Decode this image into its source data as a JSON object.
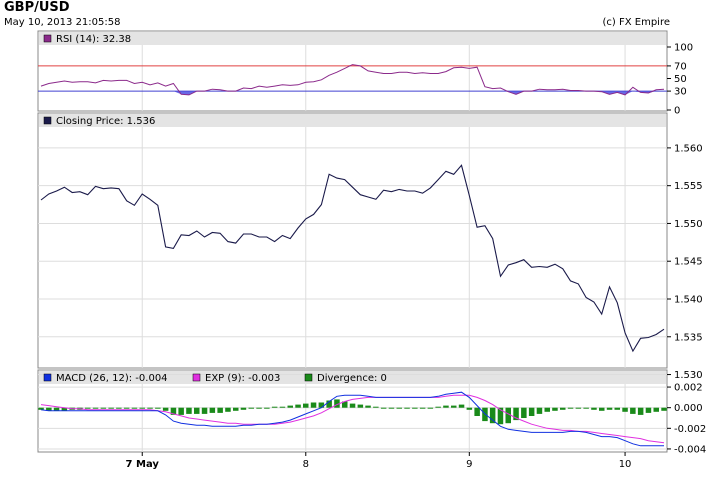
{
  "header": {
    "symbol": "GBP/USD",
    "datetime": "May 10, 2013 21:05:58",
    "copyright": "(c) FX Empire"
  },
  "colors": {
    "price": "#1a1a4a",
    "rsi": "#8b2a8b",
    "rsi_fill": "#4f4fe0",
    "overbought": "#e04040",
    "oversold": "#4040d0",
    "macd": "#1030e0",
    "exp": "#e030e0",
    "divergence": "#1a8a1a",
    "legend_bar": "#e4e4e4",
    "grid": "#dddddd"
  },
  "chart_data": [
    {
      "type": "line",
      "name": "rsi",
      "legend": "RSI (14): 32.38",
      "ylim": [
        0,
        100
      ],
      "yticks": [
        "100",
        "70",
        "50",
        "30",
        "0"
      ],
      "ytick_values": [
        100,
        70,
        50,
        30,
        0
      ],
      "levels": [
        70,
        30
      ],
      "x": [
        0,
        1,
        2,
        3,
        4,
        5,
        6,
        7,
        8,
        9,
        10,
        11,
        12,
        13,
        14,
        15,
        16,
        17,
        18,
        19,
        20,
        21,
        22,
        23,
        24,
        25,
        26,
        27,
        28,
        29,
        30,
        31,
        32,
        33,
        34,
        35,
        36,
        37,
        38,
        39,
        40,
        41,
        42,
        43,
        44,
        45,
        46,
        47,
        48,
        49,
        50,
        51,
        52,
        53,
        54,
        55,
        56,
        57,
        58,
        59,
        60,
        61,
        62,
        63,
        64,
        65,
        66,
        67,
        68,
        69,
        70,
        71,
        72,
        73,
        74,
        75,
        76,
        77,
        78,
        79,
        80
      ],
      "values": [
        38,
        42,
        44,
        46,
        44,
        45,
        45,
        43,
        47,
        46,
        47,
        47,
        42,
        44,
        40,
        43,
        38,
        42,
        25,
        24,
        30,
        30,
        33,
        32,
        30,
        30,
        35,
        34,
        38,
        36,
        38,
        40,
        39,
        40,
        44,
        45,
        48,
        55,
        60,
        66,
        72,
        70,
        62,
        60,
        58,
        58,
        60,
        60,
        58,
        59,
        58,
        58,
        61,
        67,
        68,
        66,
        68,
        37,
        34,
        35,
        29,
        25,
        30,
        30,
        33,
        32,
        32,
        33,
        31,
        31,
        30,
        30,
        29,
        25,
        28,
        24,
        36,
        28,
        27,
        32,
        33
      ]
    },
    {
      "type": "line",
      "name": "price",
      "legend": "Closing Price: 1.536",
      "ylim": [
        1.531,
        1.5625
      ],
      "yticks": [
        "1.560",
        "1.555",
        "1.550",
        "1.545",
        "1.540",
        "1.535",
        "1.530"
      ],
      "ytick_values": [
        1.56,
        1.555,
        1.55,
        1.545,
        1.54,
        1.535,
        1.53
      ],
      "x": [
        0,
        1,
        2,
        3,
        4,
        5,
        6,
        7,
        8,
        9,
        10,
        11,
        12,
        13,
        14,
        15,
        16,
        17,
        18,
        19,
        20,
        21,
        22,
        23,
        24,
        25,
        26,
        27,
        28,
        29,
        30,
        31,
        32,
        33,
        34,
        35,
        36,
        37,
        38,
        39,
        40,
        41,
        42,
        43,
        44,
        45,
        46,
        47,
        48,
        49,
        50,
        51,
        52,
        53,
        54,
        55,
        56,
        57,
        58,
        59,
        60,
        61,
        62,
        63,
        64,
        65,
        66,
        67,
        68,
        69,
        70,
        71,
        72,
        73,
        74,
        75,
        76,
        77,
        78,
        79,
        80
      ],
      "values": [
        1.5531,
        1.5539,
        1.5543,
        1.5548,
        1.5541,
        1.5542,
        1.5538,
        1.5549,
        1.5546,
        1.5547,
        1.5546,
        1.553,
        1.5524,
        1.5539,
        1.5532,
        1.5524,
        1.5469,
        1.5467,
        1.5485,
        1.5484,
        1.549,
        1.5482,
        1.5488,
        1.5487,
        1.5476,
        1.5474,
        1.5486,
        1.5486,
        1.5482,
        1.5482,
        1.5476,
        1.5484,
        1.548,
        1.5494,
        1.5506,
        1.5512,
        1.5525,
        1.5565,
        1.556,
        1.5558,
        1.5548,
        1.5538,
        1.5535,
        1.5532,
        1.5544,
        1.5542,
        1.5545,
        1.5543,
        1.5543,
        1.554,
        1.5547,
        1.5558,
        1.5569,
        1.5565,
        1.5577,
        1.5537,
        1.5495,
        1.5497,
        1.548,
        1.543,
        1.5445,
        1.5448,
        1.5452,
        1.5442,
        1.5443,
        1.5442,
        1.5446,
        1.544,
        1.5424,
        1.542,
        1.5402,
        1.5396,
        1.538,
        1.5416,
        1.5395,
        1.5355,
        1.5331,
        1.5348,
        1.5349,
        1.5353,
        1.536
      ]
    },
    {
      "type": "line",
      "name": "macd",
      "legend_macd": "MACD (26, 12): -0.004",
      "legend_exp": "EXP (9): -0.003",
      "legend_div": "Divergence: 0",
      "ylim": [
        -0.0042,
        0.0022
      ],
      "yticks": [
        "0.002",
        "0.000",
        "-0.002",
        "-0.004"
      ],
      "ytick_values": [
        0.002,
        0.0,
        -0.002,
        -0.004
      ],
      "x": [
        0,
        1,
        2,
        3,
        4,
        5,
        6,
        7,
        8,
        9,
        10,
        11,
        12,
        13,
        14,
        15,
        16,
        17,
        18,
        19,
        20,
        21,
        22,
        23,
        24,
        25,
        26,
        27,
        28,
        29,
        30,
        31,
        32,
        33,
        34,
        35,
        36,
        37,
        38,
        39,
        40,
        41,
        42,
        43,
        44,
        45,
        46,
        47,
        48,
        49,
        50,
        51,
        52,
        53,
        54,
        55,
        56,
        57,
        58,
        59,
        60,
        61,
        62,
        63,
        64,
        65,
        66,
        67,
        68,
        69,
        70,
        71,
        72,
        73,
        74,
        75,
        76,
        77,
        78,
        79,
        80
      ],
      "macd": [
        -0.0002,
        -0.0003,
        -0.0003,
        -0.0003,
        -0.0003,
        -0.0003,
        -0.0003,
        -0.0003,
        -0.0003,
        -0.0003,
        -0.0003,
        -0.0003,
        -0.0003,
        -0.0003,
        -0.0003,
        -0.0003,
        -0.0007,
        -0.0013,
        -0.0015,
        -0.0016,
        -0.0017,
        -0.0017,
        -0.0018,
        -0.0018,
        -0.0018,
        -0.0018,
        -0.0017,
        -0.0017,
        -0.0016,
        -0.0016,
        -0.0015,
        -0.0014,
        -0.0012,
        -0.0009,
        -0.0006,
        -0.0003,
        0.0,
        0.0006,
        0.0011,
        0.0012,
        0.0012,
        0.0012,
        0.0011,
        0.001,
        0.001,
        0.001,
        0.001,
        0.001,
        0.001,
        0.001,
        0.001,
        0.0011,
        0.0013,
        0.0014,
        0.0015,
        0.001,
        0.0002,
        -0.0006,
        -0.0012,
        -0.0018,
        -0.0021,
        -0.0022,
        -0.0023,
        -0.0024,
        -0.0024,
        -0.0024,
        -0.0024,
        -0.0024,
        -0.0023,
        -0.0023,
        -0.0024,
        -0.0026,
        -0.0028,
        -0.0028,
        -0.0029,
        -0.0032,
        -0.0035,
        -0.0037,
        -0.0037,
        -0.0037,
        -0.0037
      ],
      "exp": [
        0.0003,
        0.0002,
        0.0001,
        0.0,
        -0.0001,
        -0.0001,
        -0.0002,
        -0.0002,
        -0.0002,
        -0.0002,
        -0.0002,
        -0.0002,
        -0.0002,
        -0.0002,
        -0.0002,
        -0.0003,
        -0.0004,
        -0.0006,
        -0.0008,
        -0.001,
        -0.0011,
        -0.0012,
        -0.0013,
        -0.0014,
        -0.0015,
        -0.0015,
        -0.0016,
        -0.0016,
        -0.0016,
        -0.0016,
        -0.0016,
        -0.0015,
        -0.0014,
        -0.0012,
        -0.001,
        -0.0008,
        -0.0005,
        -0.0001,
        0.0003,
        0.0006,
        0.0008,
        0.0009,
        0.001,
        0.001,
        0.001,
        0.001,
        0.001,
        0.001,
        0.001,
        0.001,
        0.001,
        0.001,
        0.0011,
        0.0012,
        0.0012,
        0.0012,
        0.001,
        0.0007,
        0.0003,
        -0.0002,
        -0.0006,
        -0.001,
        -0.0013,
        -0.0016,
        -0.0018,
        -0.002,
        -0.0021,
        -0.0022,
        -0.0022,
        -0.0023,
        -0.0023,
        -0.0024,
        -0.0025,
        -0.0026,
        -0.0027,
        -0.0028,
        -0.0029,
        -0.003,
        -0.0032,
        -0.0033,
        -0.0034
      ],
      "divergence": [
        -0.0002,
        -0.0003,
        -0.0003,
        -0.0003,
        -0.0002,
        -0.0002,
        -0.0001,
        -0.0001,
        -0.0001,
        -0.0001,
        -0.0001,
        -0.0001,
        -0.0001,
        -0.0001,
        -0.0001,
        -0.0001,
        -0.0003,
        -0.0007,
        -0.0007,
        -0.0006,
        -0.0006,
        -0.0006,
        -0.0005,
        -0.0005,
        -0.0004,
        -0.0003,
        -0.0002,
        -0.0001,
        0.0,
        0.0,
        0.0001,
        0.0001,
        0.0002,
        0.0003,
        0.0004,
        0.0005,
        0.0005,
        0.0007,
        0.0008,
        0.0006,
        0.0004,
        0.0003,
        0.0002,
        0.0001,
        0.0,
        0.0,
        0.0,
        0.0,
        0.0,
        0.0,
        0.0,
        0.0001,
        0.0002,
        0.0002,
        0.0003,
        -0.0002,
        -0.0008,
        -0.0013,
        -0.0015,
        -0.0016,
        -0.0015,
        -0.0012,
        -0.001,
        -0.0008,
        -0.0006,
        -0.0004,
        -0.0003,
        -0.0002,
        -0.0001,
        0.0,
        -0.0001,
        -0.0002,
        -0.0003,
        -0.0002,
        -0.0002,
        -0.0004,
        -0.0006,
        -0.0007,
        -0.0005,
        -0.0004,
        -0.0003
      ]
    }
  ],
  "x_axis": {
    "labels": [
      "7 May",
      "8",
      "9",
      "10"
    ],
    "positions": [
      13,
      34,
      55,
      75
    ],
    "bold": [
      true,
      false,
      false,
      false
    ]
  }
}
